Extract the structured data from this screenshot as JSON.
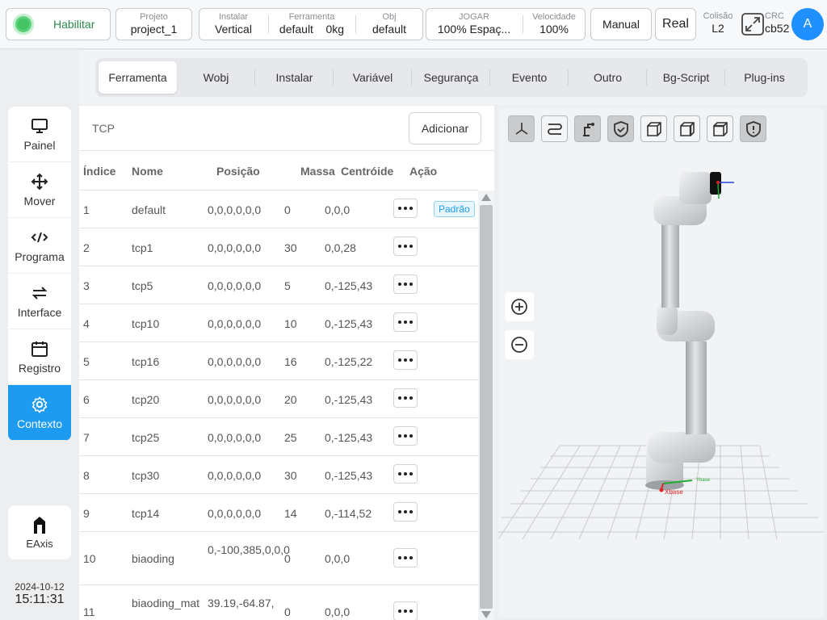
{
  "topbar": {
    "enable_label": "Habilitar",
    "project": {
      "key": "Projeto",
      "value": "project_1"
    },
    "install": {
      "key": "Instalar",
      "value": "Vertical"
    },
    "tool": {
      "key": "Ferramenta",
      "value": "default",
      "mass": "0kg"
    },
    "obj": {
      "key": "Obj",
      "value": "default"
    },
    "jog": {
      "key": "JOGAR",
      "value": "100%  Espaç..."
    },
    "speed": {
      "key": "Velocidade",
      "value": "100%"
    },
    "manual_label": "Manual",
    "real_label": "Real",
    "collision": {
      "key": "Colisão",
      "value": "L2"
    },
    "crc": {
      "key": "CRC",
      "value": "cb52"
    },
    "avatar_letter": "A",
    "enable_color": "#43c463",
    "accent_color": "#1d9bf0"
  },
  "tabs": [
    {
      "label": "Ferramenta",
      "active": true
    },
    {
      "label": "Wobj"
    },
    {
      "label": "Instalar"
    },
    {
      "label": "Variável"
    },
    {
      "label": "Segurança"
    },
    {
      "label": "Evento"
    },
    {
      "label": "Outro"
    },
    {
      "label": "Bg-Script"
    },
    {
      "label": "Plug-ins"
    }
  ],
  "sidebar": {
    "items": [
      {
        "label": "Painel",
        "icon": "monitor-icon"
      },
      {
        "label": "Mover",
        "icon": "move-arrows-icon"
      },
      {
        "label": "Programa",
        "icon": "code-icon"
      },
      {
        "label": "Interface",
        "icon": "swap-arrows-icon"
      },
      {
        "label": "Registro",
        "icon": "calendar-icon"
      },
      {
        "label": "Contexto",
        "icon": "gear-icon",
        "active": true
      }
    ],
    "eaxis_label": "EAxis",
    "date": "2024-10-12",
    "time": "15:11:31"
  },
  "panel": {
    "title": "TCP",
    "add_label": "Adicionar",
    "headers": {
      "index": "Índice",
      "name": "Nome",
      "position": "Posição",
      "mass": "Massa",
      "centroid": "Centróide",
      "action": "Ação"
    },
    "default_badge": "Padrão",
    "rows": [
      {
        "index": "1",
        "name": "default",
        "position": "0,0,0,0,0,0",
        "mass": "0",
        "centroid": "0,0,0"
      },
      {
        "index": "2",
        "name": "tcp1",
        "position": "0,0,0,0,0,0",
        "mass": "30",
        "centroid": "0,0,28"
      },
      {
        "index": "3",
        "name": "tcp5",
        "position": "0,0,0,0,0,0",
        "mass": "5",
        "centroid": "0,-125,43"
      },
      {
        "index": "4",
        "name": "tcp10",
        "position": "0,0,0,0,0,0",
        "mass": "10",
        "centroid": "0,-125,43"
      },
      {
        "index": "5",
        "name": "tcp16",
        "position": "0,0,0,0,0,0",
        "mass": "16",
        "centroid": "0,-125,22"
      },
      {
        "index": "6",
        "name": "tcp20",
        "position": "0,0,0,0,0,0",
        "mass": "20",
        "centroid": "0,-125,43"
      },
      {
        "index": "7",
        "name": "tcp25",
        "position": "0,0,0,0,0,0",
        "mass": "25",
        "centroid": "0,-125,43"
      },
      {
        "index": "8",
        "name": "tcp30",
        "position": "0,0,0,0,0,0",
        "mass": "30",
        "centroid": "0,-125,43"
      },
      {
        "index": "9",
        "name": "tcp14",
        "position": "0,0,0,0,0,0",
        "mass": "14",
        "centroid": "0,-114,52"
      },
      {
        "index": "10",
        "name": "biaoding",
        "position": "0,-100,385,0,0,0",
        "mass": "0",
        "centroid": "0,0,0"
      },
      {
        "index": "11",
        "name": "biaoding_mat",
        "position": "39.19,-64.87,",
        "mass": "0",
        "centroid": "0,0,0"
      }
    ]
  },
  "view3d": {
    "toolbar_icons": [
      "axis-view-icon",
      "path-icon",
      "robot-icon",
      "shield-check-icon",
      "cube-front-icon",
      "cube-side-icon",
      "cube-top-icon",
      "shield-alert-icon"
    ],
    "zoom_in_icon": "zoom-in-icon",
    "zoom_out_icon": "zoom-out-icon",
    "axis_x_label": "Xbase",
    "axis_y_label": "Ybase"
  }
}
